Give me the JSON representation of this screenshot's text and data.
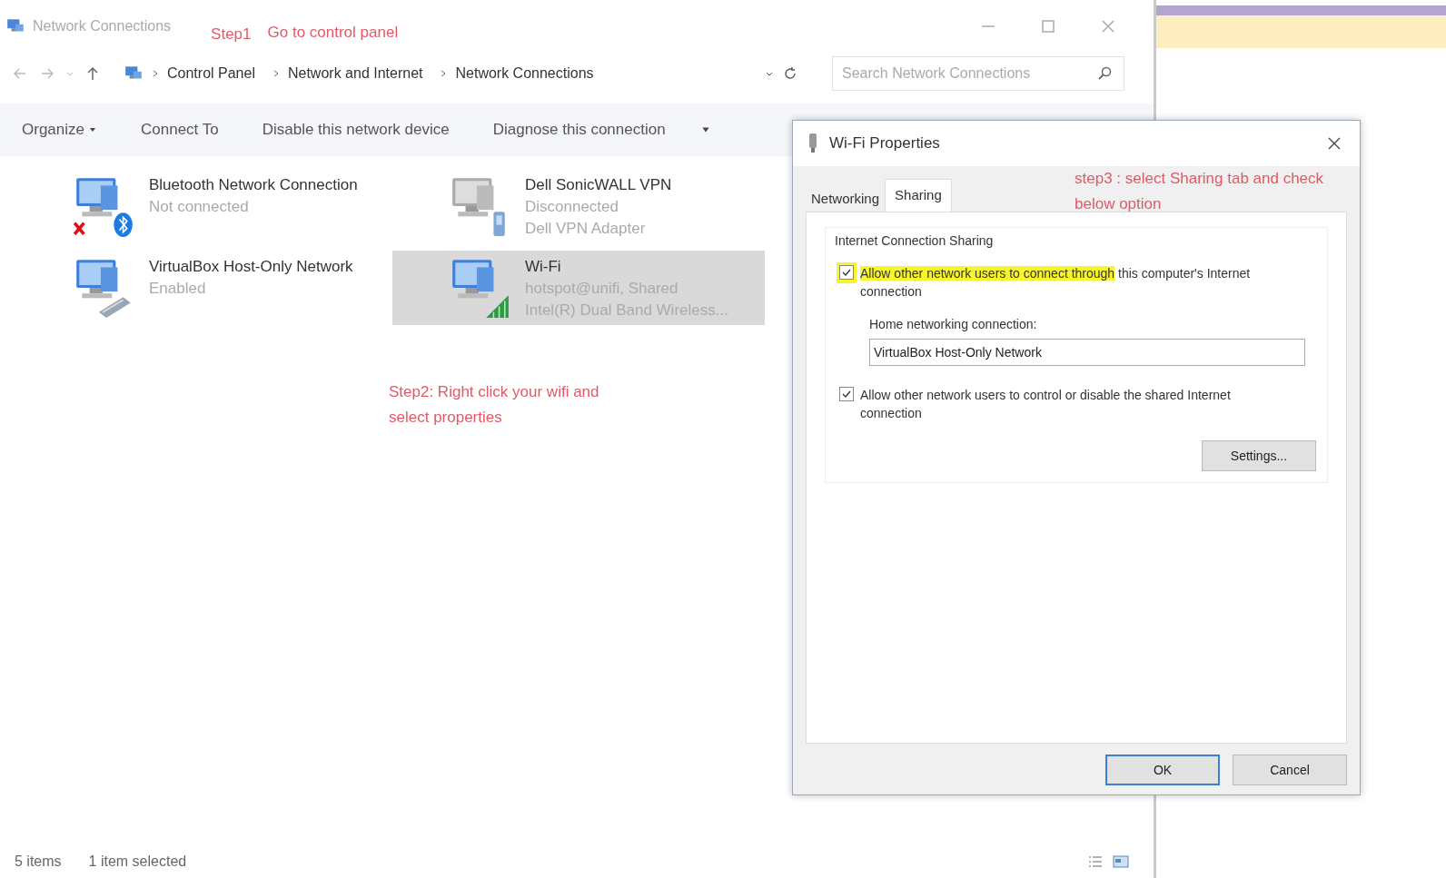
{
  "window": {
    "title": "Network Connections"
  },
  "step1": {
    "label": "Step1",
    "text": "Go to control panel"
  },
  "address": {
    "crumbs": [
      "Control Panel",
      "Network and Internet",
      "Network Connections"
    ],
    "search": {
      "placeholder": "Search Network Connections"
    }
  },
  "toolbar": [
    {
      "label": "Organize",
      "dropdown": true
    },
    {
      "label": "Connect To",
      "dropdown": false
    },
    {
      "label": "Disable this network device",
      "dropdown": false
    },
    {
      "label": "Diagnose this connection",
      "dropdown": false
    }
  ],
  "items": [
    {
      "name": "Bluetooth Network Connection",
      "status": "Not connected",
      "kind": "bluetooth",
      "error": true,
      "selected": false
    },
    {
      "name": "Dell SonicWALL VPN",
      "status": "Disconnected",
      "device": "Dell VPN Adapter",
      "kind": "vpn",
      "error": false,
      "selected": false
    },
    {
      "name": "VirtualBox Host-Only Network",
      "status": "Enabled",
      "kind": "adapter",
      "error": false,
      "selected": false
    },
    {
      "name": "Wi-Fi",
      "status": "hotspot@unifi, Shared",
      "device": "Intel(R) Dual Band Wireless...",
      "kind": "wifi",
      "error": false,
      "selected": true
    }
  ],
  "step2": "Step2: Right click your wifi and select properties",
  "status_bar": {
    "count": "5 items",
    "selection": "1 item selected"
  },
  "dialog": {
    "title": "Wi-Fi Properties",
    "tabs": [
      {
        "label": "Networking",
        "selected": false
      },
      {
        "label": "Sharing",
        "selected": true
      }
    ],
    "step3": "step3 : select Sharing tab and check below option",
    "group": "Internet Connection Sharing",
    "options": [
      {
        "checked": true,
        "highlight": "Allow other network users to connect through",
        "text": "this computer's Internet connection"
      },
      {
        "checked": true,
        "text": "Allow other network users to control or disable the shared Internet connection"
      }
    ],
    "home_label": "Home networking connection:",
    "home_value": "VirtualBox Host-Only Network",
    "settings_button": "Settings...",
    "buttons": [
      {
        "label": "OK",
        "default": true
      },
      {
        "label": "Cancel",
        "default": false
      }
    ]
  }
}
